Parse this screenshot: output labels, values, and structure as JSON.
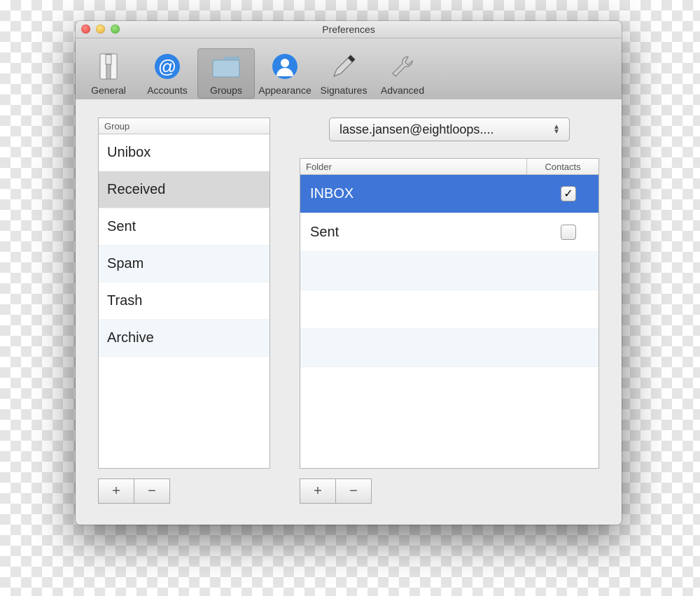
{
  "window": {
    "title": "Preferences"
  },
  "toolbar": {
    "items": [
      {
        "label": "General",
        "selected": false
      },
      {
        "label": "Accounts",
        "selected": false
      },
      {
        "label": "Groups",
        "selected": true
      },
      {
        "label": "Appearance",
        "selected": false
      },
      {
        "label": "Signatures",
        "selected": false
      },
      {
        "label": "Advanced",
        "selected": false
      }
    ]
  },
  "left": {
    "header": "Group",
    "items": [
      {
        "label": "Unibox",
        "selected": false
      },
      {
        "label": "Received",
        "selected": true
      },
      {
        "label": "Sent",
        "selected": false
      },
      {
        "label": "Spam",
        "selected": false
      },
      {
        "label": "Trash",
        "selected": false
      },
      {
        "label": "Archive",
        "selected": false
      }
    ],
    "buttons": {
      "add": "+",
      "remove": "−"
    }
  },
  "right": {
    "account_popup": "lasse.jansen@eightloops....",
    "headers": {
      "folder": "Folder",
      "contacts": "Contacts"
    },
    "items": [
      {
        "label": "INBOX",
        "selected": true,
        "checked": true
      },
      {
        "label": "Sent",
        "selected": false,
        "checked": false
      }
    ],
    "buttons": {
      "add": "+",
      "remove": "−"
    }
  }
}
